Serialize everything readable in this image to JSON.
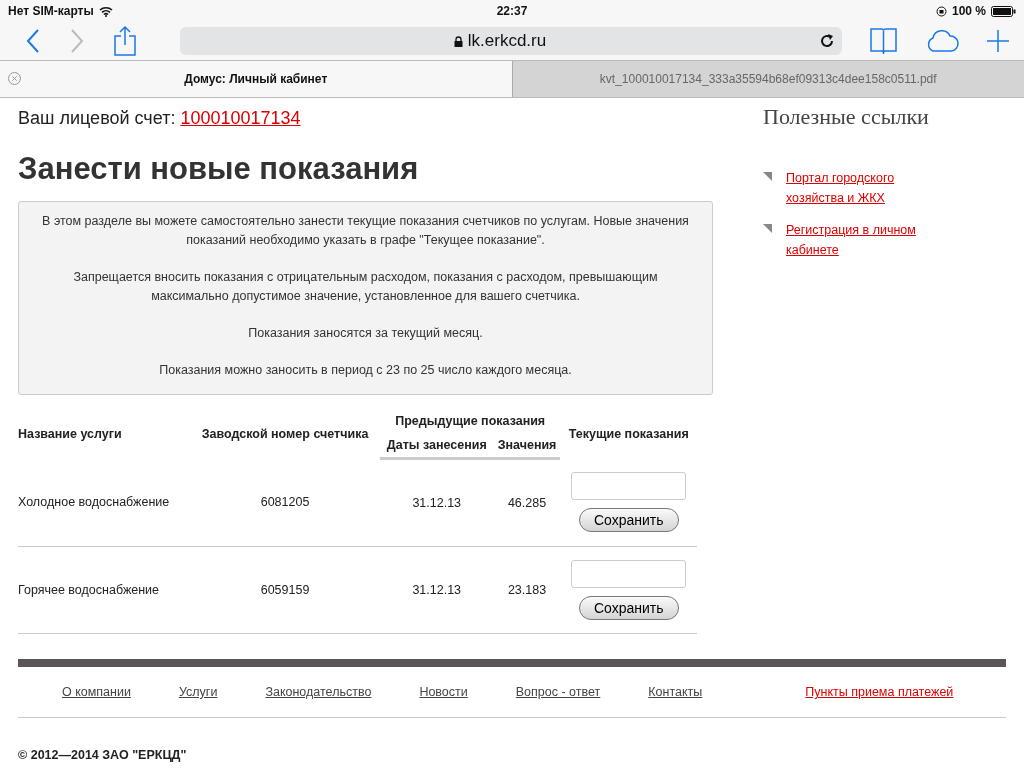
{
  "status_bar": {
    "carrier": "Нет SIM-карты",
    "time": "22:37",
    "battery": "100 %"
  },
  "toolbar": {
    "url": "lk.erkcd.ru"
  },
  "tabs": [
    {
      "label": "Домус: Личный кабинет",
      "selected": true
    },
    {
      "label": "kvt_100010017134_333a35594b68ef09313c4dee158c0511.pdf",
      "selected": false
    }
  ],
  "account": {
    "label": "Ваш лицевой счет:",
    "number": "100010017134"
  },
  "heading": "Занести новые показания",
  "info": [
    "В этом разделе вы можете самостоятельно занести текущие показания счетчиков по услугам. Новые значения показаний необходимо указать в графе \"Текущее показание\".",
    "Запрещается вносить показания с отрицательным расходом, показания с расходом, превышающим максимально допустимое значение, установленное для вашего счетчика.",
    "Показания заносятся за текущий месяц.",
    "Показания можно заносить в период с 23 по 25 число каждого месяца."
  ],
  "table": {
    "columns": {
      "service": "Название услуги",
      "serial": "Заводской номер счетчика",
      "previous": "Предыдущие показания",
      "date": "Даты занесения",
      "value": "Значения",
      "current": "Текущие показания"
    },
    "rows": [
      {
        "service": "Холодное водоснабжение",
        "serial": "6081205",
        "date": "31.12.13",
        "value": "46.285",
        "button": "Сохранить"
      },
      {
        "service": "Горячее водоснабжение",
        "serial": "6059159",
        "date": "31.12.13",
        "value": "23.183",
        "button": "Сохранить"
      }
    ]
  },
  "sidebar": {
    "title": "Полезные ссылки",
    "links": [
      "Портал городского хозяйства и ЖКХ",
      "Регистрация в личном кабинете"
    ]
  },
  "footer": {
    "links": [
      {
        "label": "О компании",
        "kind": "plain"
      },
      {
        "label": "Услуги",
        "kind": "plain"
      },
      {
        "label": "Законодательство",
        "kind": "plain"
      },
      {
        "label": "Новости",
        "kind": "plain"
      },
      {
        "label": "Вопрос - ответ",
        "kind": "plain"
      },
      {
        "label": "Контакты",
        "kind": "plain"
      },
      {
        "label": "Пункты приема платежей",
        "kind": "accent"
      }
    ],
    "copyright": "© 2012—2014 ЗАО \"ЕРКЦД\""
  }
}
